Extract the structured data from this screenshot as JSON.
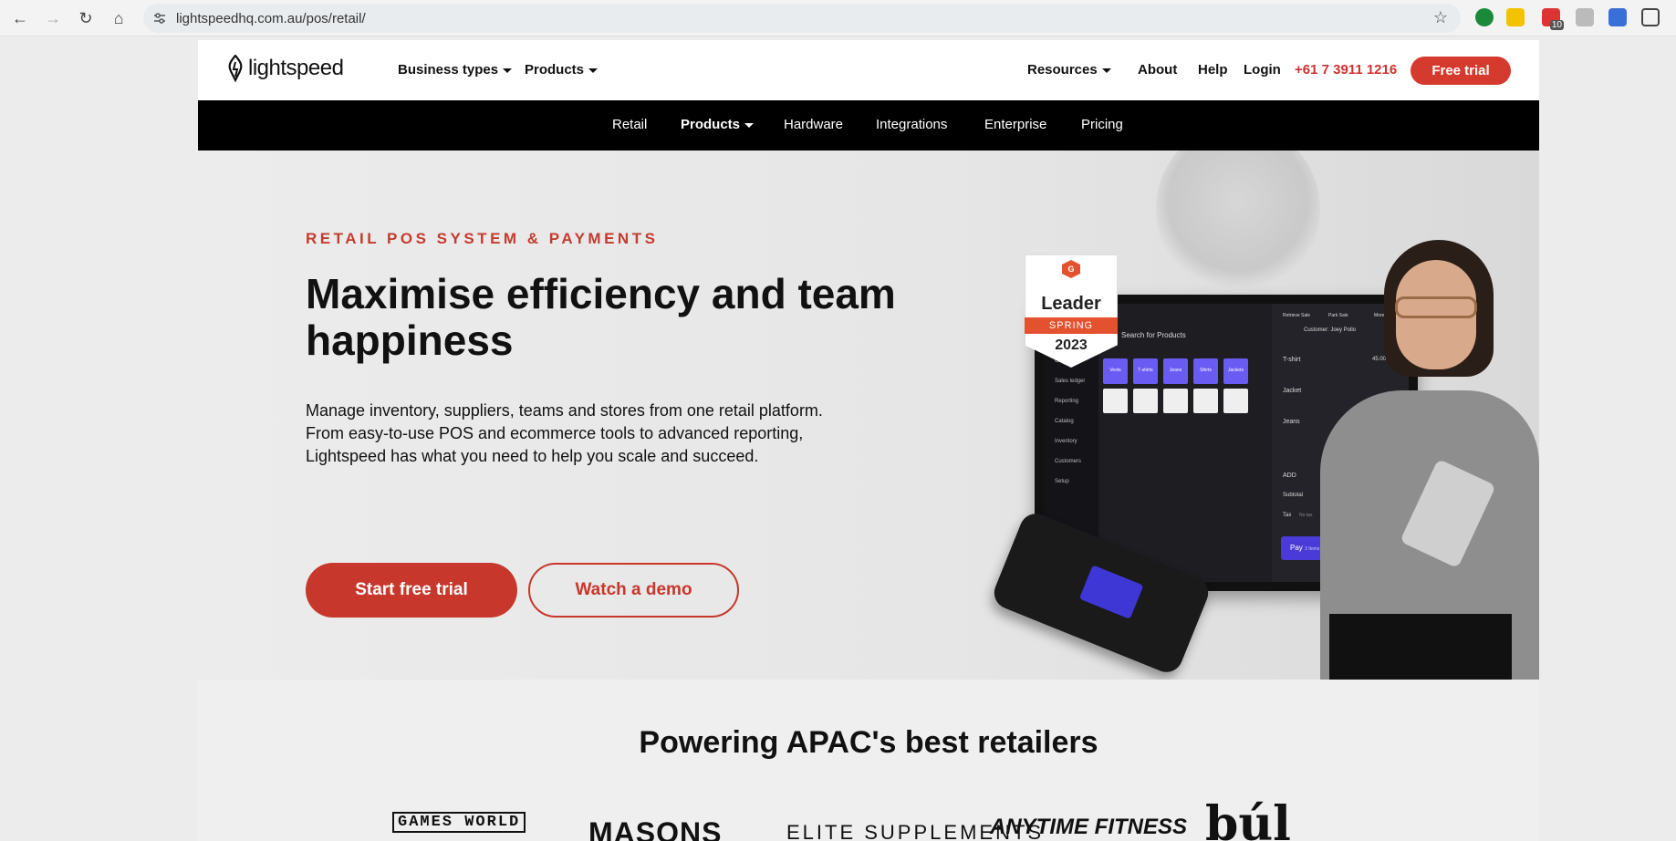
{
  "browser": {
    "url": "lightspeedhq.com.au/pos/retail/",
    "extension_badge": "10",
    "icons": [
      "back-icon",
      "forward-icon",
      "reload-icon",
      "home-icon",
      "tune-icon",
      "star-icon"
    ]
  },
  "topnav": {
    "logo_text": "lightspeed",
    "items": [
      "Business types",
      "Products"
    ],
    "right_items": [
      "Resources",
      "About",
      "Help",
      "Login"
    ],
    "phone": "+61 7 3911 1216",
    "cta": "Free trial"
  },
  "subnav": {
    "items": [
      "Retail",
      "Products",
      "Hardware",
      "Integrations",
      "Enterprise",
      "Pricing"
    ]
  },
  "hero": {
    "eyebrow": "RETAIL POS SYSTEM & PAYMENTS",
    "title": "Maximise efficiency and team happiness",
    "body": "Manage inventory, suppliers, teams and stores from one retail platform. From easy-to-use POS and ecommerce tools to advanced reporting, Lightspeed has what you need to help you scale and succeed.",
    "primary_cta": "Start free trial",
    "secondary_cta": "Watch a demo"
  },
  "badge": {
    "brand": "G",
    "title": "Leader",
    "season": "SPRING",
    "year": "2023"
  },
  "pos_screen": {
    "search": "Search for Products",
    "categories": [
      "Vests",
      "T-shirts",
      "Jeans",
      "Shirts",
      "Jackets"
    ],
    "sidebar": [
      "Online",
      "Sales ledger",
      "Reporting",
      "Catalog",
      "Inventory",
      "Customers",
      "Setup"
    ],
    "actions": [
      "Retrieve Sale",
      "Park Sale",
      "More Act"
    ],
    "customer": "Customer: Joey Pollo",
    "lines": [
      "T-shirt",
      "Jacket",
      "Jeans"
    ],
    "tshirt_price": "45.00",
    "add": "ADD",
    "subtotal": "Subtotal",
    "tax": "Tax",
    "tax_note": "No tax",
    "pay": "Pay",
    "pay_items": "3 Items"
  },
  "section2": {
    "title": "Powering APAC's best retailers",
    "brands": [
      "GAMES WORLD",
      "MASONS",
      "ELITE SUPPLEMENTS",
      "ANYTIME FITNESS",
      "búl"
    ]
  },
  "colors": {
    "brand_red": "#d53a2e",
    "nav_black": "#000000",
    "pos_purple": "#6a5cf2"
  }
}
